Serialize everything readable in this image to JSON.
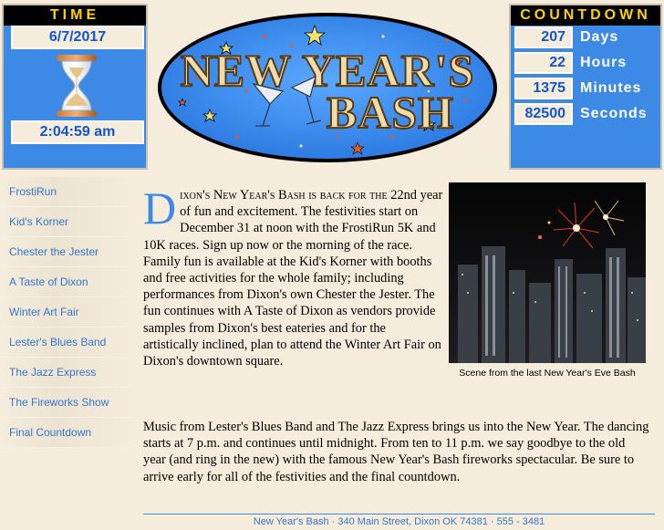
{
  "time_panel": {
    "title": "Time",
    "date": "6/7/2017",
    "clock": "2:04:59 am",
    "icon": "hourglass-icon"
  },
  "countdown": {
    "title": "Countdown",
    "rows": [
      {
        "value": "207",
        "label": "Days"
      },
      {
        "value": "22",
        "label": "Hours"
      },
      {
        "value": "1375",
        "label": "Minutes"
      },
      {
        "value": "82500",
        "label": "Seconds"
      }
    ]
  },
  "logo": {
    "line1": "NEW YEAR'S",
    "line2": "BASH"
  },
  "sidebar": {
    "items": [
      {
        "label": "FrostiRun"
      },
      {
        "label": "Kid's Korner"
      },
      {
        "label": "Chester the Jester"
      },
      {
        "label": "A Taste of Dixon"
      },
      {
        "label": "Winter Art Fair"
      },
      {
        "label": "Lester's Blues Band"
      },
      {
        "label": "The Jazz Express"
      },
      {
        "label": "The Fireworks Show"
      },
      {
        "label": "Final Countdown"
      }
    ]
  },
  "main": {
    "dropcap": "D",
    "p1_lead": "ixon's New Year's Bash is back for the",
    "p1_body": "22nd year of fun and excitement. The festivities start on December 31 at noon with the FrostiRun 5K and 10K races. Sign up now or the morning of the race. Family fun is available at the Kid's Korner with booths and free activities for the whole family; including performances from Dixon's own Chester the Jester. The fun continues with A Taste of Dixon as vendors provide samples from Dixon's best eateries and for the artistically inclined, plan to attend the Winter Art Fair on Dixon's downtown square.",
    "p2": "Music from Lester's Blues Band and The Jazz Express brings us into the New Year. The dancing starts at 7 p.m. and continues until midnight. From ten to 11 p.m. we say goodbye to the old year (and ring in the new) with the famous New Year's Bash fireworks spectacular. Be sure to arrive early for all of the festivities and the final countdown."
  },
  "photo": {
    "caption": "Scene from the last New Year's Eve Bash"
  },
  "footer": {
    "text": "New Year's Bash · 340 Main Street, Dixon OK 74381 · 555 - 3481"
  },
  "colors": {
    "accent_blue": "#3c8ae6",
    "header_yellow": "#ffd200",
    "background": "#f5ecdc"
  }
}
